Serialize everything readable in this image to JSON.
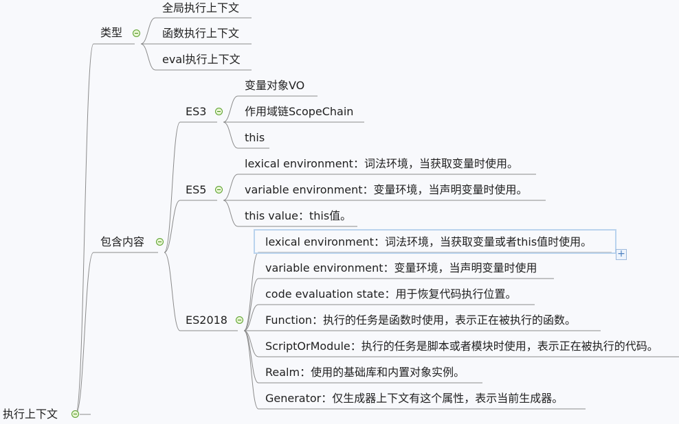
{
  "root": {
    "label": "执行上下文"
  },
  "types": {
    "label": "类型",
    "items": [
      "全局执行上下文",
      "函数执行上下文",
      "eval执行上下文"
    ]
  },
  "contents": {
    "label": "包含内容",
    "es3": {
      "label": "ES3",
      "items": [
        "变量对象VO",
        "作用域链ScopeChain",
        "this"
      ]
    },
    "es5": {
      "label": "ES5",
      "items": [
        "lexical environment：词法环境，当获取变量时使用。",
        "variable environment：变量环境，当声明变量时使用。",
        "this value：this值。"
      ]
    },
    "es2018": {
      "label": "ES2018",
      "items": [
        "lexical environment：词法环境，当获取变量或者this值时使用。",
        "variable environment：变量环境，当声明变量时使用",
        "code evaluation state：用于恢复代码执行位置。",
        "Function：执行的任务是函数时使用，表示正在被执行的函数。",
        "ScriptOrModule：执行的任务是脚本或者模块时使用，表示正在被执行的代码。",
        "Realm：使用的基础库和内置对象实例。",
        "Generator：仅生成器上下文有这个属性，表示当前生成器。"
      ]
    }
  },
  "add_button": {
    "symbol": "+"
  },
  "colors": {
    "line": "#8a8a8a",
    "toggle_border": "#5aa02c",
    "toggle_fill": "#e6f5d0",
    "selection": "#b9d3ee"
  }
}
